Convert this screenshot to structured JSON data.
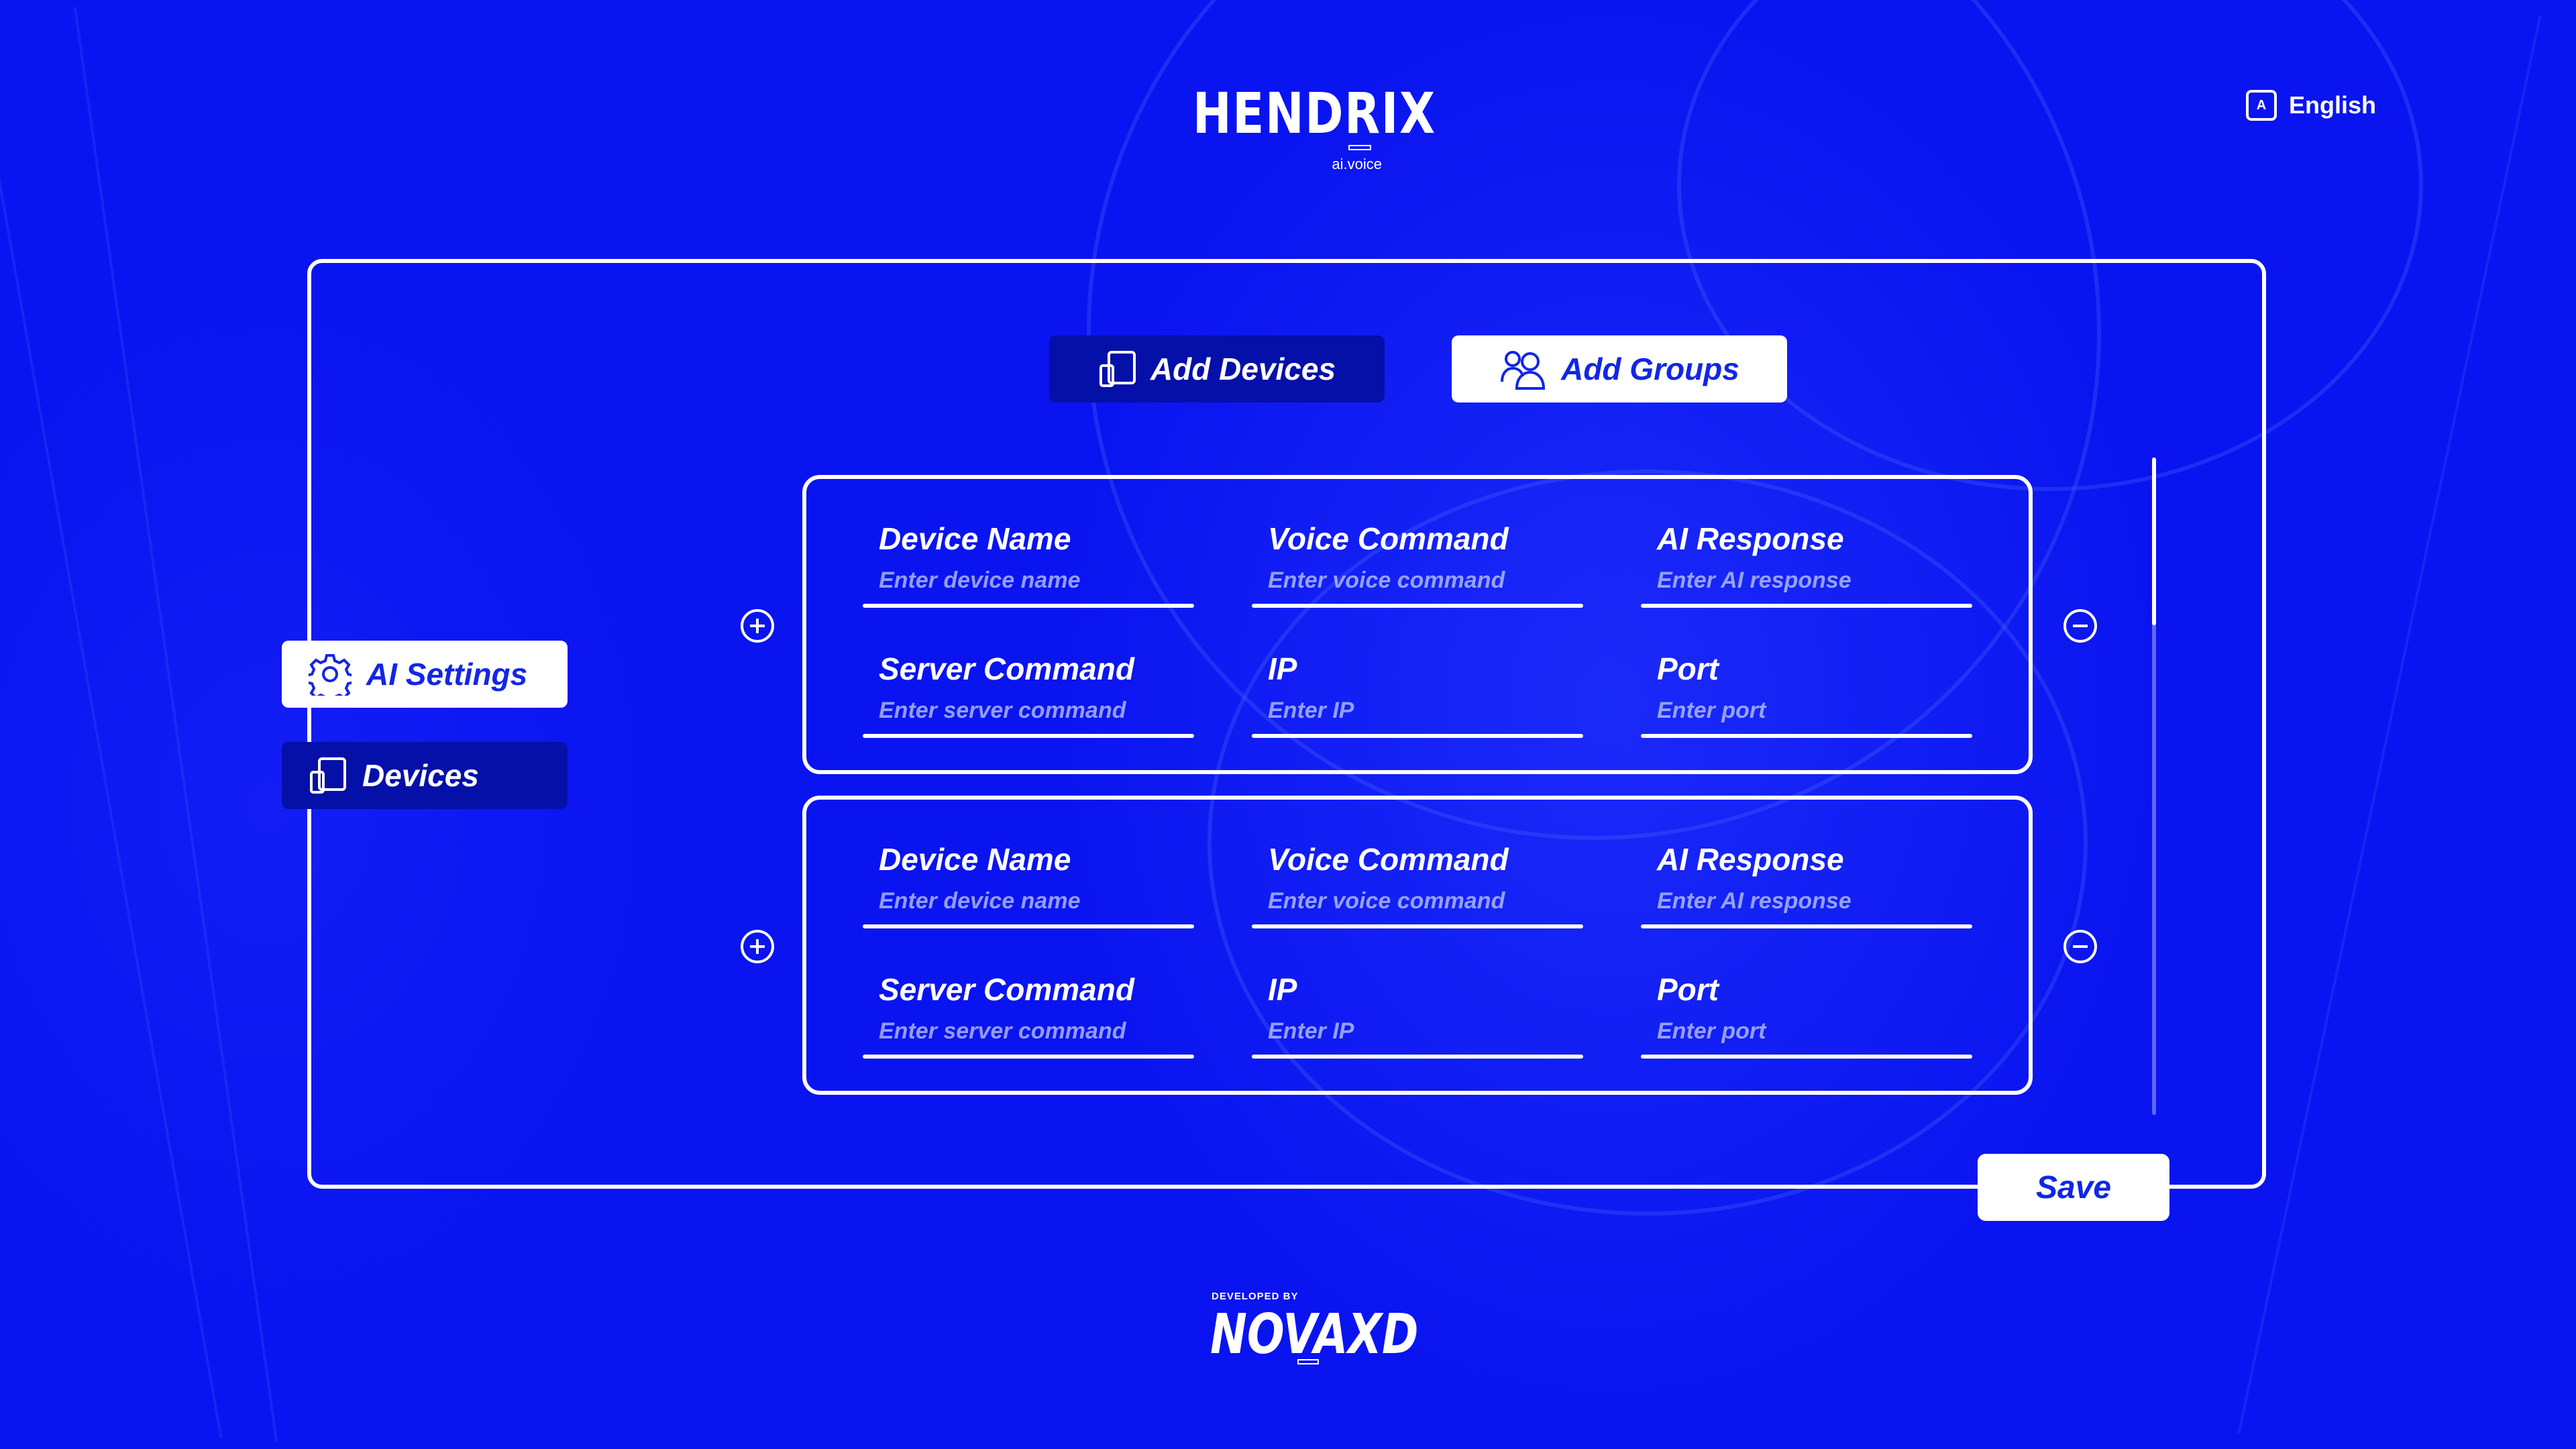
{
  "brand": {
    "name": "HENDRIX",
    "sub": "ai.voice"
  },
  "language": {
    "icon_letter": "A",
    "label": "English"
  },
  "tabs": {
    "add_devices": "Add Devices",
    "add_groups": "Add Groups"
  },
  "sidebar": {
    "ai_settings": "AI Settings",
    "devices": "Devices"
  },
  "cards": [
    {
      "device_name": {
        "label": "Device Name",
        "placeholder": "Enter device name"
      },
      "voice_command": {
        "label": "Voice Command",
        "placeholder": "Enter voice command"
      },
      "ai_response": {
        "label": "AI Response",
        "placeholder": "Enter AI response"
      },
      "server_command": {
        "label": "Server Command",
        "placeholder": "Enter server command"
      },
      "ip": {
        "label": "IP",
        "placeholder": "Enter IP"
      },
      "port": {
        "label": "Port",
        "placeholder": "Enter port"
      }
    },
    {
      "device_name": {
        "label": "Device Name",
        "placeholder": "Enter device name"
      },
      "voice_command": {
        "label": "Voice Command",
        "placeholder": "Enter voice command"
      },
      "ai_response": {
        "label": "AI Response",
        "placeholder": "Enter AI response"
      },
      "server_command": {
        "label": "Server Command",
        "placeholder": "Enter server command"
      },
      "ip": {
        "label": "IP",
        "placeholder": "Enter IP"
      },
      "port": {
        "label": "Port",
        "placeholder": "Enter port"
      }
    }
  ],
  "save_label": "Save",
  "footer": {
    "developed_by": "DEVELOPED BY",
    "brand": "NOVAXD"
  },
  "icons": {
    "language": "language-icon",
    "add_devices": "devices-icon",
    "add_groups": "users-icon",
    "ai_settings": "gear-icon",
    "devices": "devices-icon",
    "add_row": "plus-circle-icon",
    "remove_row": "minus-circle-icon"
  },
  "colors": {
    "background": "#0a14f0",
    "accent": "#1226e6",
    "dark_button": "#0510a8",
    "white": "#ffffff"
  }
}
